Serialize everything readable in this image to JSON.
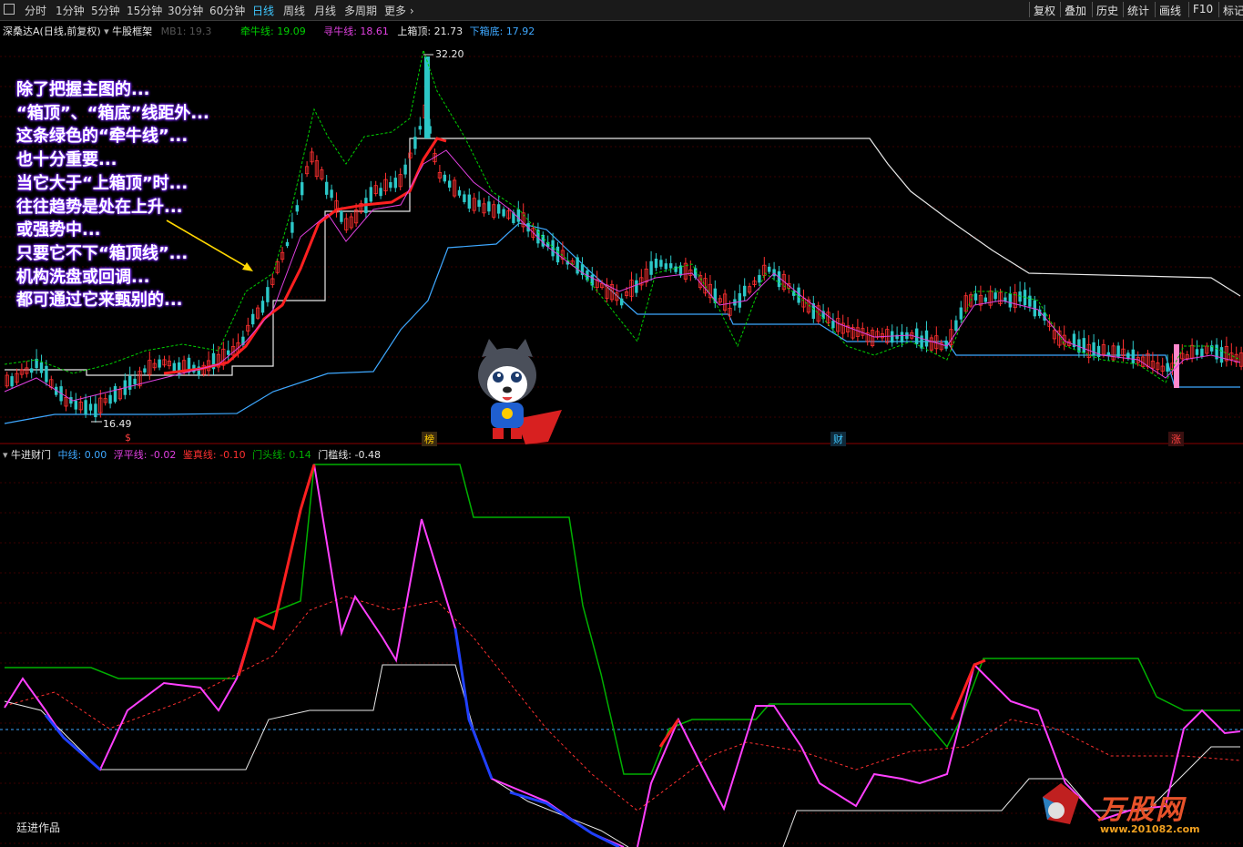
{
  "toolbar": {
    "periods": [
      "分时",
      "1分钟",
      "5分钟",
      "15分钟",
      "30分钟",
      "60分钟",
      "日线",
      "周线",
      "月线",
      "多周期",
      "更多"
    ],
    "active_period": "日线",
    "buttons": [
      "复权",
      "叠加",
      "历史",
      "统计",
      "画线",
      "F10",
      "标记"
    ]
  },
  "main_chart": {
    "stock_name": "深桑达A",
    "period_label": "(日线,前复权)",
    "indicator_name": "牛股框架",
    "mb_label": "MB1: 19.3",
    "lines": [
      {
        "label": "牵牛线",
        "value": "19.09",
        "color": "#00d000"
      },
      {
        "label": "寻牛线",
        "value": "18.61",
        "color": "#e040e0"
      },
      {
        "label": "上箱顶",
        "value": "21.73",
        "color": "#e8e8e8"
      },
      {
        "label": "下箱底",
        "value": "17.92",
        "color": "#3ea8ff"
      }
    ],
    "high_label": "32.20",
    "low_label": "16.49",
    "event_marks": [
      {
        "text": "$",
        "color": "#ff4040"
      },
      {
        "text": "榜",
        "color": "#ffcc00"
      },
      {
        "text": "财",
        "color": "#3ec7ff"
      },
      {
        "text": "涨",
        "color": "#ff4040"
      }
    ]
  },
  "annotation": {
    "lines": [
      "除了把握主图的...",
      "“箱顶”、“箱底”线距外...",
      "这条绿色的“牵牛线”...",
      "也十分重要...",
      "当它大于“上箱顶”时...",
      "往往趋势是处在上升...",
      "或强势中...",
      "只要它不下“箱顶线”...",
      "机构洗盘或回调...",
      "都可通过它来甄别的..."
    ]
  },
  "sub_chart": {
    "indicator_name": "牛进财门",
    "lines": [
      {
        "label": "中线",
        "value": "0.00",
        "color": "#3ea8ff"
      },
      {
        "label": "浮平线",
        "value": "-0.02",
        "color": "#e040e0"
      },
      {
        "label": "鉴真线",
        "value": "-0.10",
        "color": "#ff3030"
      },
      {
        "label": "门头线",
        "value": "0.14",
        "color": "#00b000"
      },
      {
        "label": "门槛线",
        "value": "-0.48",
        "color": "#e8e8e8"
      }
    ]
  },
  "footer": {
    "author": "廷进作品",
    "watermark": "万股网",
    "watermark_url": "www.201082.com"
  }
}
